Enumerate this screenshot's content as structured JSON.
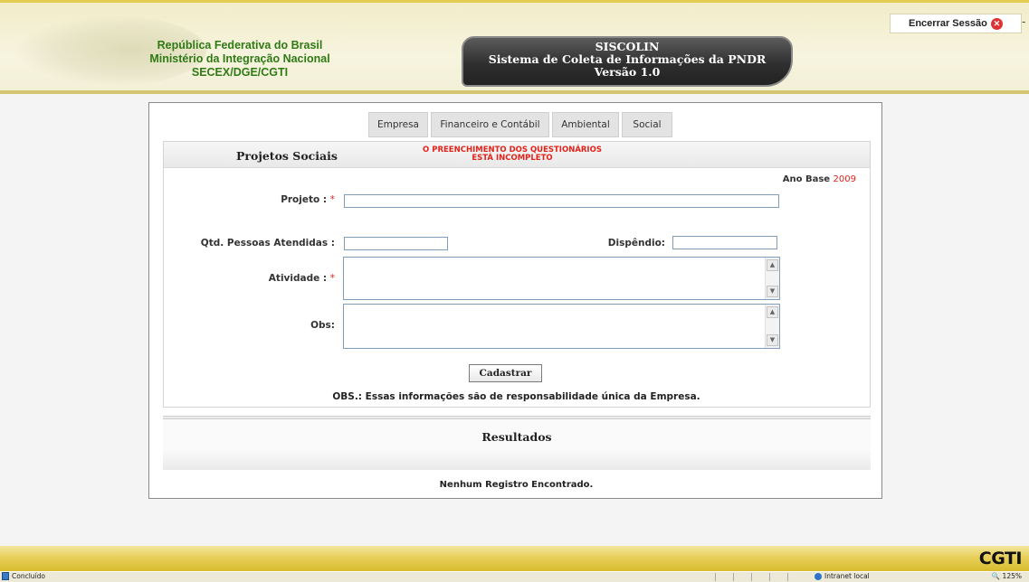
{
  "header": {
    "org_lines": [
      "República Federativa do Brasil",
      "Ministério da Integração Nacional",
      "SECEX/DGE/CGTI"
    ],
    "system_lines": [
      "SISCOLIN",
      "Sistema de Coleta de Informações da PNDR",
      "Versão 1.0"
    ],
    "logout_label": "Encerrar Sessão"
  },
  "tabs": [
    "Empresa",
    "Financeiro e Contábil",
    "Ambiental",
    "Social"
  ],
  "form": {
    "title": "Projetos Sociais",
    "warning_lines": [
      "O PREENCHIMENTO DOS QUESTIONÁRIOS",
      "ESTÁ INCOMPLETO"
    ],
    "ano_base_label": "Ano Base",
    "ano_base_value": "2009",
    "projeto_label": "Projeto :",
    "qtd_label": "Qtd. Pessoas Atendidas :",
    "dispendio_label": "Dispêndio:",
    "atividade_label": "Atividade :",
    "obs_label": "Obs:",
    "required_mark": "*",
    "submit_label": "Cadastrar",
    "note": "OBS.: Essas informações são de responsabilidade única da Empresa."
  },
  "results": {
    "title": "Resultados",
    "empty_message": "Nenhum Registro Encontrado."
  },
  "footer": {
    "logo_text": "CGTI"
  },
  "statusbar": {
    "left_text": "Concluído",
    "zone_text": "Intranet local",
    "zoom_text": "125%"
  },
  "colors": {
    "required": "#e2231a",
    "org_text": "#2f7a14",
    "header_bg": "#f1ecc9",
    "footer_gold": "#d8bc2e"
  }
}
